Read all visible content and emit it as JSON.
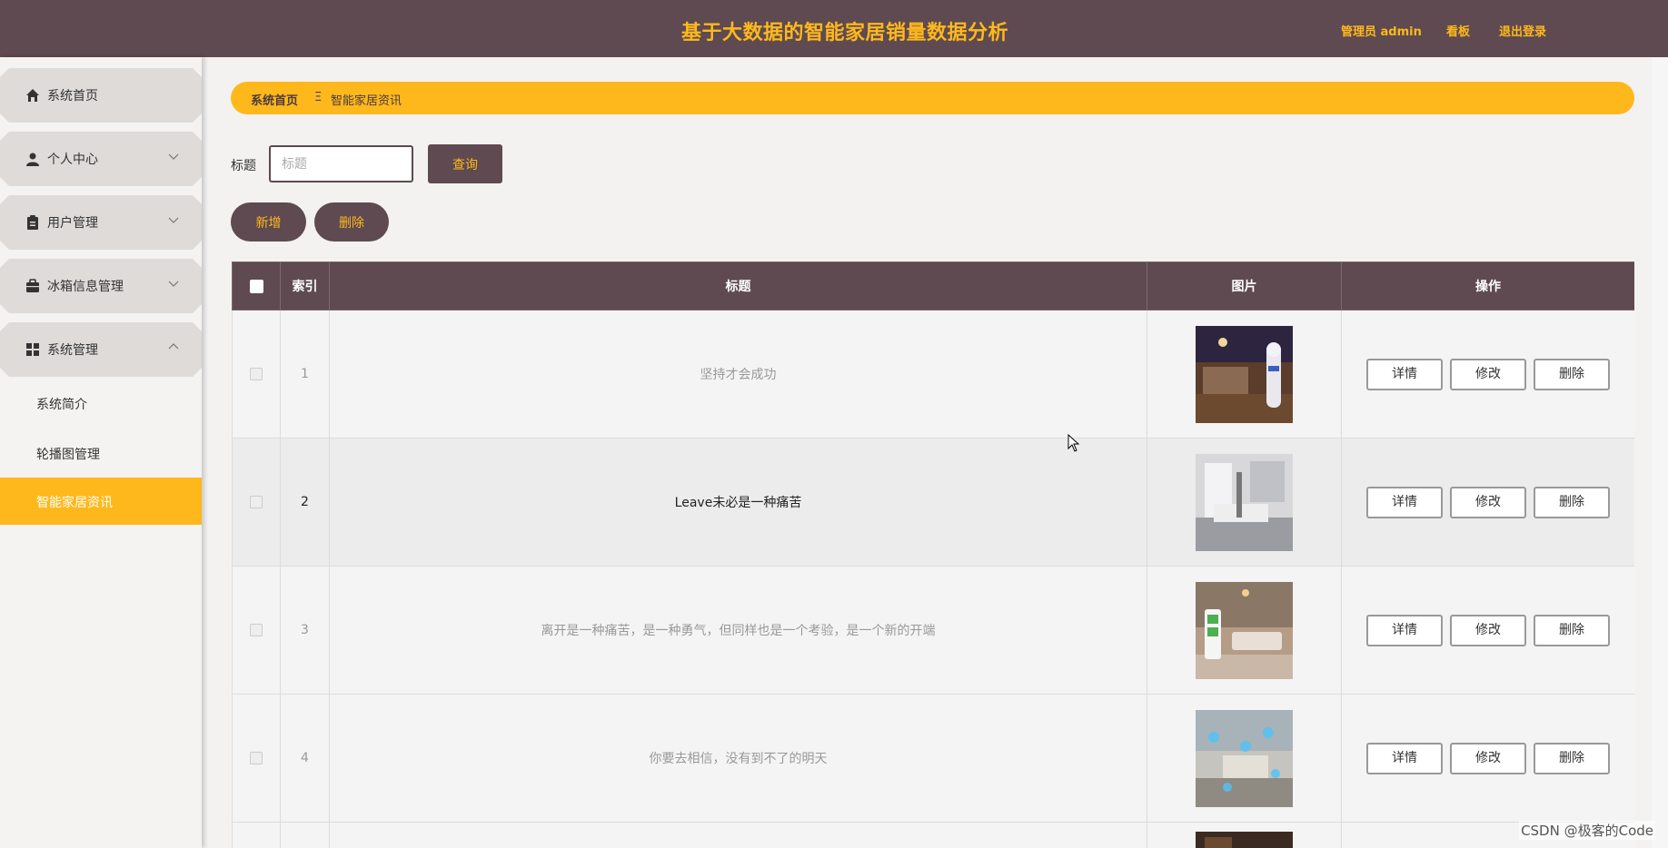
{
  "header": {
    "title": "基于大数据的智能家居销量数据分析",
    "links": [
      "管理员 admin",
      "看板",
      "退出登录"
    ]
  },
  "sidebar": {
    "items": [
      {
        "label": "系统首页",
        "icon": "home-icon"
      },
      {
        "label": "个人中心",
        "icon": "user-icon"
      },
      {
        "label": "用户管理",
        "icon": "clipboard-icon"
      },
      {
        "label": "冰箱信息管理",
        "icon": "briefcase-icon"
      },
      {
        "label": "系统管理",
        "icon": "grid-icon"
      }
    ],
    "subitems": [
      "系统简介",
      "轮播图管理",
      "智能家居资讯"
    ],
    "active_subitem": "智能家居资讯"
  },
  "breadcrumb": {
    "home": "系统首页",
    "separator": "Ξ",
    "current": "智能家居资讯"
  },
  "search": {
    "label": "标题",
    "placeholder": "标题",
    "button": "查询"
  },
  "actions": {
    "add": "新增",
    "delete": "删除"
  },
  "table": {
    "headers": [
      "索引",
      "标题",
      "图片",
      "操作"
    ],
    "rows": [
      {
        "index": "1",
        "title": "坚持才会成功",
        "image": "robot-bedroom-photo"
      },
      {
        "index": "2",
        "title": "Leave未必是一种痛苦",
        "image": "white-interior-photo"
      },
      {
        "index": "3",
        "title": "离开是一种痛苦，是一种勇气，但同样也是一个考验，是一个新的开端",
        "image": "living-room-phone-photo"
      },
      {
        "index": "4",
        "title": "你要去相信，没有到不了的明天",
        "image": "smart-home-icons-photo"
      }
    ],
    "ops": [
      "详情",
      "修改",
      "删除"
    ]
  },
  "watermark": "CSDN @极客的Code",
  "colors": {
    "primary_dark": "#5e4a50",
    "accent": "#ffb81c"
  }
}
